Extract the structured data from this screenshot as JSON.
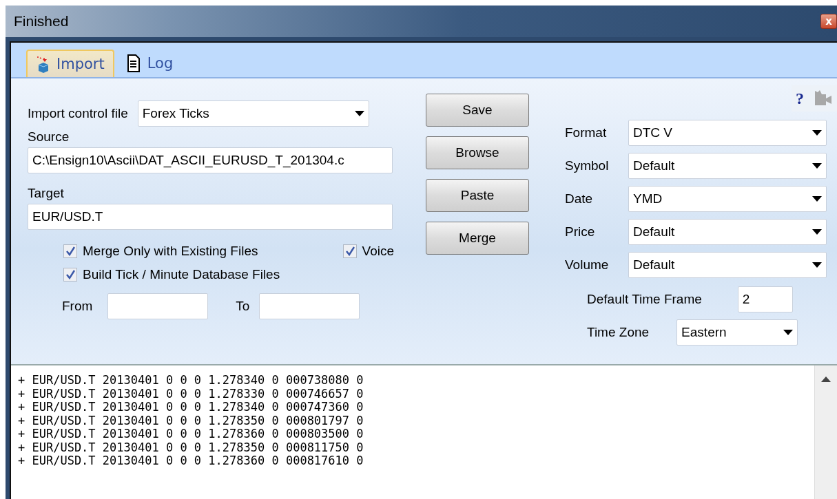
{
  "window": {
    "title": "Finished",
    "close": "x"
  },
  "tabs": [
    {
      "label": "Import",
      "selected": true,
      "kind": "import"
    },
    {
      "label": "Log",
      "selected": false,
      "kind": "log"
    }
  ],
  "help": "?",
  "import_control": {
    "label": "Import control file",
    "value": "Forex Ticks"
  },
  "source": {
    "label": "Source",
    "value": "C:\\Ensign10\\Ascii\\DAT_ASCII_EURUSD_T_201304.c"
  },
  "target": {
    "label": "Target",
    "value": "EUR/USD.T"
  },
  "buttons": [
    "Save",
    "Browse",
    "Paste",
    "Merge"
  ],
  "checkboxes": [
    {
      "label": "Merge Only with Existing Files",
      "checked": true
    },
    {
      "label": "Voice",
      "checked": true
    },
    {
      "label": "Build Tick / Minute Database Files",
      "checked": true
    }
  ],
  "from": {
    "label": "From"
  },
  "to": {
    "label": "To"
  },
  "settings": [
    {
      "label": "Format",
      "value": "DTC V"
    },
    {
      "label": "Symbol",
      "value": "Default"
    },
    {
      "label": "Date",
      "value": "YMD"
    },
    {
      "label": "Price",
      "value": "Default"
    },
    {
      "label": "Volume",
      "value": "Default"
    }
  ],
  "default_time_frame": {
    "label": "Default Time Frame",
    "value": "2"
  },
  "time_zone": {
    "label": "Time Zone",
    "value": "Eastern"
  },
  "log": [
    "+ EUR/USD.T 20130401 0 0 0 1.278340 0 000738080 0",
    "+ EUR/USD.T 20130401 0 0 0 1.278330 0 000746657 0",
    "+ EUR/USD.T 20130401 0 0 0 1.278340 0 000747360 0",
    "+ EUR/USD.T 20130401 0 0 0 1.278350 0 000801797 0",
    "+ EUR/USD.T 20130401 0 0 0 1.278360 0 000803500 0",
    "+ EUR/USD.T 20130401 0 0 0 1.278350 0 000811750 0",
    "+ EUR/USD.T 20130401 0 0 0 1.278360 0 000817610 0"
  ]
}
